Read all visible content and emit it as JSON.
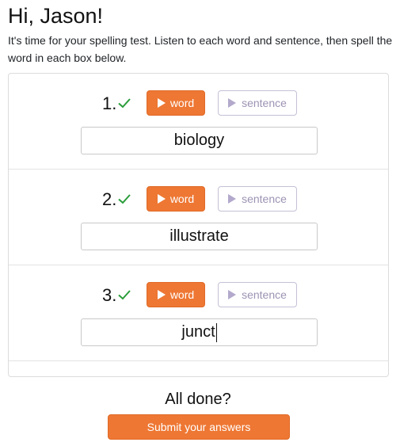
{
  "greeting": "Hi, Jason!",
  "instructions": "It's time for your spelling test. Listen to each word and sentence, then spell the word in each box below.",
  "items": [
    {
      "number": "1.",
      "word_label": "word",
      "sentence_label": "sentence",
      "answer": "biology",
      "status_icon": "check-icon"
    },
    {
      "number": "2.",
      "word_label": "word",
      "sentence_label": "sentence",
      "answer": "illustrate",
      "status_icon": "check-icon"
    },
    {
      "number": "3.",
      "word_label": "word",
      "sentence_label": "sentence",
      "answer": "junct",
      "status_icon": "check-icon"
    }
  ],
  "footer": {
    "prompt": "All done?",
    "submit_label": "Submit your answers"
  },
  "colors": {
    "accent": "#ee7733",
    "check": "#2a9d3a",
    "sentence_button_text": "#9d93b3"
  }
}
